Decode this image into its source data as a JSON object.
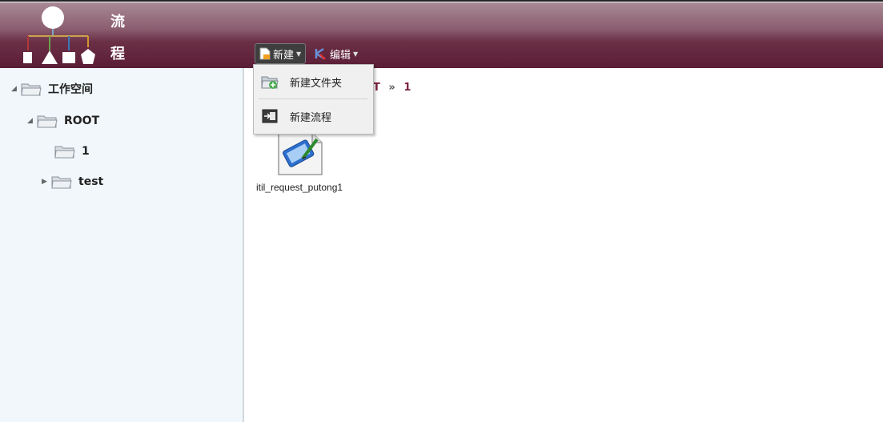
{
  "header": {
    "logo_title_1": "流",
    "logo_title_2": "程"
  },
  "toolbar": {
    "new_label": "新建",
    "edit_label": "编辑"
  },
  "new_menu": {
    "items": [
      {
        "label": "新建文件夹",
        "icon": "add-folder-icon"
      },
      {
        "label": "新建流程",
        "icon": "new-process-icon"
      }
    ]
  },
  "tree": {
    "root": "工作空间",
    "items": [
      {
        "label": "ROOT",
        "expanded": true
      },
      {
        "label": "1",
        "expanded": false
      },
      {
        "label": "test",
        "expanded": false
      }
    ]
  },
  "breadcrumb": {
    "partial": "T",
    "separator": "»",
    "current": "1"
  },
  "files": [
    {
      "name": "itil_request_putong1",
      "icon": "process-file-icon"
    }
  ],
  "colors": {
    "header_dark": "#5a1d35",
    "breadcrumb": "#7a1f3d",
    "sidebar_bg": "#f1f7fb"
  }
}
